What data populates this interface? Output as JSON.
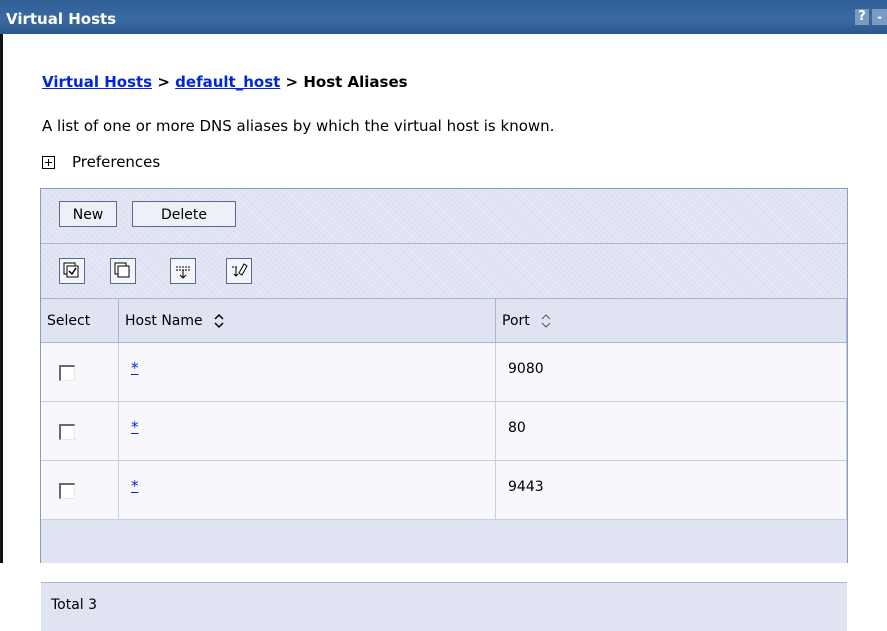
{
  "window": {
    "title": "Virtual Hosts",
    "help_glyph": "?",
    "min_glyph": "-"
  },
  "breadcrumb": {
    "items": [
      "Virtual Hosts",
      "default_host"
    ],
    "separator": ">",
    "current": "Host Aliases"
  },
  "description": "A list of one or more DNS aliases by which the virtual host is known.",
  "preferences_label": "Preferences",
  "toolbar": {
    "new_label": "New",
    "delete_label": "Delete",
    "icons": [
      "select-all-icon",
      "deselect-all-icon",
      "show-filter-icon",
      "clear-filter-icon"
    ]
  },
  "table": {
    "columns": [
      "Select",
      "Host Name",
      "Port"
    ],
    "rows": [
      {
        "host": "*",
        "port": "9080"
      },
      {
        "host": "*",
        "port": "80"
      },
      {
        "host": "*",
        "port": "9443"
      }
    ],
    "total_label": "Total 3"
  },
  "colors": {
    "titlebar": "#3a6aa3",
    "link": "#0026d6",
    "panel": "#dfe3f2"
  }
}
